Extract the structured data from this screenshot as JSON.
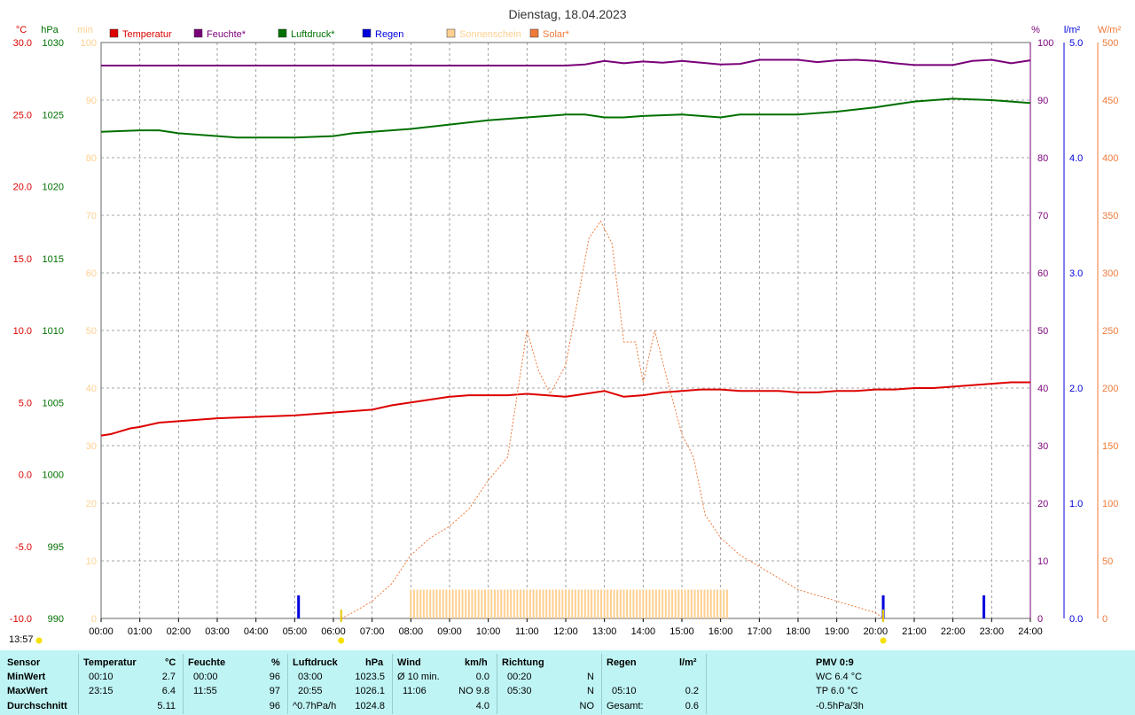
{
  "title": "Dienstag, 18.04.2023",
  "colors": {
    "temperature": "#dd0000",
    "humidity": "#7a007a",
    "pressure": "#007000",
    "rain": "#0000dd",
    "sunshine": "#ffd090",
    "solar": "#f07a3a",
    "grid": "#888888",
    "panel_bg": "#bff4f4"
  },
  "chart_data": {
    "type": "line",
    "title": "Dienstag, 18.04.2023",
    "x_ticks": [
      "00:00",
      "01:00",
      "02:00",
      "03:00",
      "04:00",
      "05:00",
      "06:00",
      "07:00",
      "08:00",
      "09:00",
      "10:00",
      "11:00",
      "12:00",
      "13:00",
      "14:00",
      "15:00",
      "16:00",
      "17:00",
      "18:00",
      "19:00",
      "20:00",
      "21:00",
      "22:00",
      "23:00",
      "24:00"
    ],
    "axes": {
      "temperature": {
        "unit": "°C",
        "range": [
          -10,
          30
        ],
        "ticks": [
          "30.0",
          "25.0",
          "20.0",
          "15.0",
          "10.0",
          "5.0",
          "0.0",
          "-5.0",
          "-10.0"
        ]
      },
      "pressure": {
        "unit": "hPa",
        "range": [
          990,
          1030
        ],
        "ticks": [
          "1030",
          "1025",
          "1020",
          "1015",
          "1010",
          "1005",
          "1000",
          "995",
          "990"
        ]
      },
      "sunshine": {
        "unit": "min",
        "range": [
          0,
          100
        ],
        "ticks": [
          "100",
          "90",
          "80",
          "70",
          "60",
          "50",
          "40",
          "30",
          "20",
          "10",
          "0"
        ]
      },
      "humidity": {
        "unit": "%",
        "range": [
          0,
          100
        ],
        "ticks": [
          "100",
          "90",
          "80",
          "70",
          "60",
          "50",
          "40",
          "30",
          "20",
          "10",
          "0"
        ]
      },
      "rain": {
        "unit": "l/m²",
        "range": [
          0,
          5
        ],
        "ticks": [
          "5.0",
          "4.0",
          "3.0",
          "2.0",
          "1.0",
          "0.0"
        ]
      },
      "solar": {
        "unit": "W/m²",
        "range": [
          0,
          500
        ],
        "ticks": [
          "500",
          "450",
          "400",
          "350",
          "300",
          "250",
          "200",
          "150",
          "100",
          "50",
          "0"
        ]
      }
    },
    "legend": [
      "Temperatur",
      "Feuchte*",
      "Luftdruck*",
      "Regen",
      "Sonnenschein",
      "Solar*"
    ],
    "series": [
      {
        "name": "Temperatur",
        "axis": "temperature",
        "x": [
          0,
          0.25,
          0.75,
          1,
          1.5,
          2,
          3,
          4,
          5,
          6,
          6.5,
          7,
          7.5,
          8,
          8.5,
          9,
          9.5,
          10,
          10.5,
          11,
          11.5,
          12,
          12.5,
          13,
          13.5,
          14,
          14.5,
          15,
          15.5,
          16,
          16.5,
          17,
          17.5,
          18,
          18.5,
          19,
          19.5,
          20,
          20.5,
          21,
          21.5,
          22,
          22.5,
          23,
          23.5,
          24
        ],
        "y": [
          2.7,
          2.8,
          3.2,
          3.3,
          3.6,
          3.7,
          3.9,
          4.0,
          4.1,
          4.3,
          4.4,
          4.5,
          4.8,
          5.0,
          5.2,
          5.4,
          5.5,
          5.5,
          5.5,
          5.6,
          5.5,
          5.4,
          5.6,
          5.8,
          5.4,
          5.5,
          5.7,
          5.8,
          5.9,
          5.9,
          5.8,
          5.8,
          5.8,
          5.7,
          5.7,
          5.8,
          5.8,
          5.9,
          5.9,
          6.0,
          6.0,
          6.1,
          6.2,
          6.3,
          6.4,
          6.4
        ]
      },
      {
        "name": "Feuchte*",
        "axis": "humidity",
        "x": [
          0,
          12,
          12.5,
          13,
          13.5,
          14,
          14.5,
          15,
          15.5,
          16,
          16.5,
          17,
          17.5,
          18,
          18.5,
          19,
          19.5,
          20,
          20.5,
          21,
          21.5,
          22,
          22.5,
          23,
          23.5,
          24
        ],
        "y": [
          96,
          96,
          96.2,
          96.8,
          96.4,
          96.7,
          96.5,
          96.8,
          96.5,
          96.2,
          96.3,
          97,
          97,
          97,
          96.6,
          96.9,
          97,
          96.8,
          96.4,
          96.1,
          96.1,
          96.1,
          96.8,
          97,
          96.4,
          96.9
        ]
      },
      {
        "name": "Luftdruck*",
        "axis": "pressure",
        "x": [
          0,
          1,
          1.5,
          2,
          3,
          3.5,
          4,
          5,
          6,
          6.5,
          7,
          8,
          9,
          10,
          11,
          12,
          12.5,
          13,
          13.5,
          14,
          15,
          16,
          16.5,
          17,
          18,
          19,
          20,
          21,
          22,
          23,
          23.5,
          24
        ],
        "y": [
          1023.8,
          1023.9,
          1023.9,
          1023.7,
          1023.5,
          1023.4,
          1023.4,
          1023.4,
          1023.5,
          1023.7,
          1023.8,
          1024.0,
          1024.3,
          1024.6,
          1024.8,
          1025.0,
          1025.0,
          1024.8,
          1024.8,
          1024.9,
          1025.0,
          1024.8,
          1025.0,
          1025.0,
          1025.0,
          1025.2,
          1025.5,
          1025.9,
          1026.1,
          1026.0,
          1025.9,
          1025.8
        ]
      },
      {
        "name": "Solar*",
        "axis": "solar",
        "x": [
          6.2,
          6.5,
          7,
          7.5,
          8,
          8.5,
          9,
          9.5,
          10,
          10.5,
          11,
          11.3,
          11.6,
          12,
          12.3,
          12.6,
          12.9,
          13.2,
          13.5,
          13.8,
          14,
          14.3,
          14.6,
          15,
          15.3,
          15.6,
          16,
          16.5,
          17,
          17.5,
          18,
          18.5,
          19,
          19.5,
          20,
          20.2
        ],
        "y": [
          0,
          5,
          15,
          30,
          55,
          70,
          80,
          95,
          120,
          140,
          250,
          215,
          195,
          220,
          275,
          330,
          345,
          325,
          240,
          240,
          205,
          250,
          210,
          160,
          140,
          90,
          70,
          55,
          45,
          35,
          25,
          20,
          15,
          10,
          5,
          0
        ]
      }
    ],
    "sunshine_bars": {
      "axis": "sunshine",
      "start_hour": 8,
      "end_hour": 16.2,
      "typical_value": 5
    },
    "rain_bars": {
      "axis": "rain",
      "x": [
        5.1,
        20.2,
        22.8
      ],
      "y": [
        0.2,
        0.2,
        0.2
      ]
    },
    "markers": [
      {
        "x": 6.2,
        "label": "sunrise"
      },
      {
        "x": 20.2,
        "label": "sunset"
      }
    ]
  },
  "bottom_left_time": "13:57",
  "panel": {
    "sensor": {
      "header": "Sensor",
      "min": "MinWert",
      "max": "MaxWert",
      "avg": "Durchschnitt"
    },
    "temperature": {
      "header": "Temperatur",
      "unit": "°C",
      "min_time": "00:10",
      "min_val": "2.7",
      "max_time": "23:15",
      "max_val": "6.4",
      "avg": "5.11"
    },
    "humidity": {
      "header": "Feuchte",
      "unit": "%",
      "min_time": "00:00",
      "min_val": "96",
      "max_time": "11:55",
      "max_val": "97",
      "avg": "96"
    },
    "pressure": {
      "header": "Luftdruck",
      "unit": "hPa",
      "min_time": "03:00",
      "min_val": "1023.5",
      "max_time": "20:55",
      "max_val": "1026.1",
      "trend": "^0.7hPa/h",
      "avg": "1024.8"
    },
    "wind": {
      "header": "Wind",
      "unit": "km/h",
      "min_label": "Ø 10 min.",
      "min_val": "0.0",
      "max_time": "11:06",
      "max_val": "NO 9.8",
      "avg": "4.0"
    },
    "direction": {
      "header": "Richtung",
      "min_time": "00:20",
      "min_val": "N",
      "max_time": "05:30",
      "max_val": "N",
      "avg": "NO"
    },
    "rain": {
      "header": "Regen",
      "unit": "l/m²",
      "max_time": "05:10",
      "max_val": "0.2",
      "total_label": "Gesamt:",
      "total": "0.6"
    },
    "pmv": {
      "header": "PMV 0:9",
      "wc": "WC 6.4 °C",
      "tp": "TP 6.0 °C",
      "trend": "-0.5hPa/3h"
    }
  }
}
